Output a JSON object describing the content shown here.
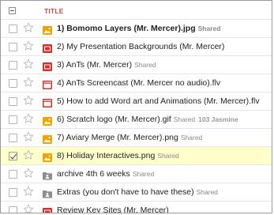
{
  "header": {
    "title": "TITLE"
  },
  "colors": {
    "accent": "#d14836",
    "image_icon": "#f0a400",
    "presentation_icon": "#d93025",
    "video_icon": "#d93025",
    "folder_icon": "#8f8f8f",
    "selected_row": "#ffffcc"
  },
  "files": [
    {
      "name": "1) Bomomo Layers (Mr. Mercer).jpg",
      "shared": "Shared",
      "owner": "",
      "icon": "image-icon",
      "bold": true,
      "checked": false
    },
    {
      "name": "2) My Presentation Backgrounds (Mr. Mercer)",
      "shared": "",
      "owner": "",
      "icon": "presentation-icon",
      "bold": false,
      "checked": false
    },
    {
      "name": "3) AnTs (Mr. Mercer)",
      "shared": "Shared",
      "owner": "",
      "icon": "presentation-icon",
      "bold": false,
      "checked": false
    },
    {
      "name": "4) AnTs Screencast (Mr. Mercer no audio).flv",
      "shared": "",
      "owner": "",
      "icon": "video-icon",
      "bold": false,
      "checked": false
    },
    {
      "name": "5) How to add Word art and Animations (Mr. Mercer).flv",
      "shared": "",
      "owner": "",
      "icon": "video-icon",
      "bold": false,
      "checked": false
    },
    {
      "name": "6) Scratch logo (Mr. Mercer).gif",
      "shared": "Shared",
      "owner": "103 Jasmine",
      "icon": "image-icon",
      "bold": false,
      "checked": false
    },
    {
      "name": "7) Aviary Merge (Mr. Mercer).png",
      "shared": "Shared",
      "owner": "",
      "icon": "image-icon",
      "bold": false,
      "checked": false
    },
    {
      "name": "8) Holiday Interactives.png",
      "shared": "Shared",
      "owner": "",
      "icon": "image-icon",
      "bold": false,
      "checked": true
    },
    {
      "name": "archive 4th 6 weeks",
      "shared": "Shared",
      "owner": "",
      "icon": "shared-folder-icon",
      "bold": false,
      "checked": false
    },
    {
      "name": "Extras (you don't have to have these)",
      "shared": "Shared",
      "owner": "",
      "icon": "shared-folder-icon",
      "bold": false,
      "checked": false
    },
    {
      "name": "Review Key Sites (Mr. Mercer)",
      "shared": "",
      "owner": "",
      "icon": "presentation-icon",
      "bold": false,
      "checked": false
    }
  ]
}
